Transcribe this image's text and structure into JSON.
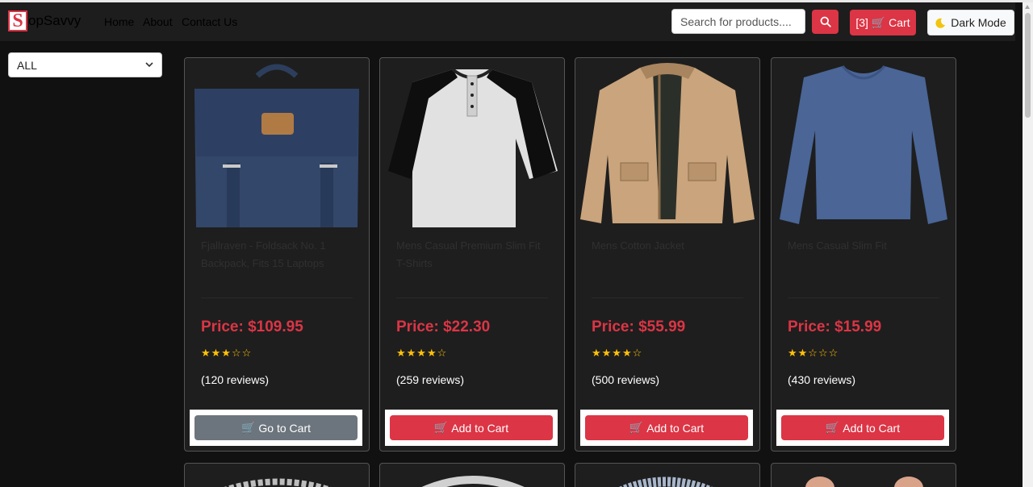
{
  "brand": {
    "letter": "S",
    "name": "opSavvy"
  },
  "nav": [
    "Home",
    "About",
    "Contact Us"
  ],
  "search": {
    "placeholder": "Search for products...."
  },
  "cart": {
    "label": "[3] 🛒 Cart"
  },
  "mode": {
    "label": "Dark Mode"
  },
  "filter": {
    "value": "ALL"
  },
  "products": [
    {
      "title": "Fjallraven - Foldsack No. 1 Backpack, Fits 15 Laptops",
      "price": "Price: $109.95",
      "stars": "★★★☆☆",
      "reviews": "(120 reviews)",
      "button": "Go to Cart"
    },
    {
      "title": "Mens Casual Premium Slim Fit T-Shirts",
      "price": "Price: $22.30",
      "stars": "★★★★☆",
      "reviews": "(259 reviews)",
      "button": "Add to Cart"
    },
    {
      "title": "Mens Cotton Jacket",
      "price": "Price: $55.99",
      "stars": "★★★★☆",
      "reviews": "(500 reviews)",
      "button": "Add to Cart"
    },
    {
      "title": "Mens Casual Slim Fit",
      "price": "Price: $15.99",
      "stars": "★★☆☆☆",
      "reviews": "(430 reviews)",
      "button": "Add to Cart"
    }
  ],
  "colors": {
    "accent": "#dc3545",
    "secondary": "#6c757d",
    "star": "#ffc107",
    "background": "#111111",
    "card": "#1e1e1e"
  }
}
